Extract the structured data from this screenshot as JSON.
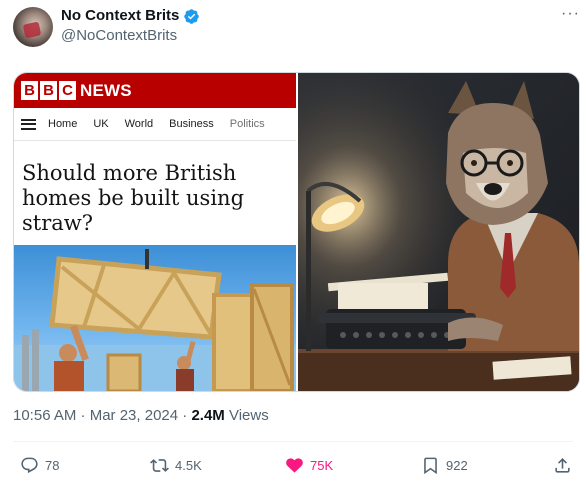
{
  "author": {
    "display_name": "No Context Brits",
    "handle": "@NoContextBrits",
    "verified_icon": "verified-badge-icon",
    "badge_color": "#1d9bf0"
  },
  "menu_icon": "more-dots-icon",
  "more_label": "···",
  "media": {
    "left_image": {
      "brand_letters": [
        "B",
        "B",
        "C"
      ],
      "brand_word": "NEWS",
      "brand_color": "#b80000",
      "nav_items": [
        "Home",
        "UK",
        "World",
        "Business",
        "Politics"
      ],
      "headline": "Should more British homes be built using straw?",
      "photo_subject": "workers lifting straw wall panels"
    },
    "right_image": {
      "subject": "wolf in glasses and tweed jacket at a typewriter under a desk lamp"
    }
  },
  "meta": {
    "time": "10:56 AM · Mar 23, 2024 · ",
    "views_count": "2.4M",
    "views_label": " Views"
  },
  "actions": {
    "replies": {
      "icon": "reply-icon",
      "count": "78"
    },
    "reposts": {
      "icon": "repost-icon",
      "count": "4.5K"
    },
    "likes": {
      "icon": "heart-icon",
      "count": "75K",
      "active": true,
      "color": "#f91880"
    },
    "bookmarks": {
      "icon": "bookmark-icon",
      "count": "922"
    },
    "share": {
      "icon": "share-icon"
    }
  }
}
